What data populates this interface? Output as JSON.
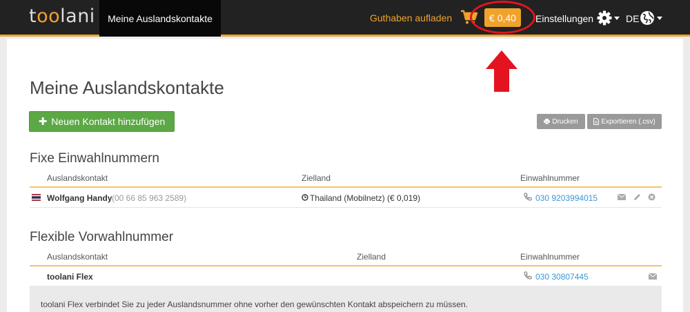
{
  "navbar": {
    "logo_prefix": "t",
    "logo_oo": "oo",
    "logo_suffix": "lani",
    "active_item": "Meine Auslandskontakte",
    "topup_label": "Guthaben aufladen",
    "balance": "€ 0,40",
    "settings_label": "Einstellungen",
    "language": "DE"
  },
  "page": {
    "title": "Meine Auslandskontakte",
    "add_button": "Neuen Kontakt hinzufügen",
    "print_button": "Drucken",
    "export_button": "Exportieren (.csv)"
  },
  "fixed_section": {
    "title": "Fixe Einwahlnummern",
    "columns": [
      "Auslandskontakt",
      "Zielland",
      "Einwahlnummer"
    ],
    "rows": [
      {
        "name": "Wolfgang Handy",
        "number": "(00 66 85 963 2589)",
        "destination": "Thailand (Mobilnetz) (€ 0,019)",
        "dial_in": "030 9203994015"
      }
    ]
  },
  "flex_section": {
    "title": "Flexible Vorwahlnummer",
    "columns": [
      "Auslandskontakt",
      "Zielland",
      "Einwahlnummer"
    ],
    "rows": [
      {
        "name": "toolani Flex",
        "dial_in": "030 30807445"
      }
    ],
    "info": "toolani Flex verbindet Sie zu jeder Auslandsnummer ohne vorher den gewünschten Kontakt abspeichern zu müssen."
  },
  "colors": {
    "accent": "#f0a32b",
    "navbar_bg": "#222222",
    "button_green": "#5ba845",
    "annotation_red": "#e3141f",
    "link": "#3b97d3"
  },
  "icons": [
    "cart-icon",
    "gear-icon",
    "globe-icon",
    "plus-icon",
    "print-icon",
    "file-icon",
    "flag-thailand-icon",
    "clock-icon",
    "phone-icon",
    "envelope-icon",
    "pencil-icon",
    "remove-icon"
  ]
}
